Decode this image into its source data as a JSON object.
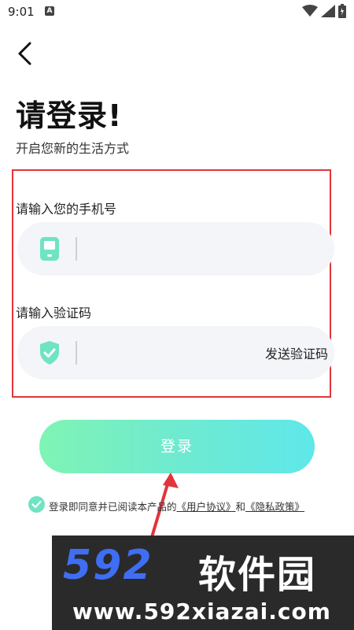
{
  "status_bar": {
    "time": "9:01",
    "notification_glyph": "A",
    "icons": [
      "wifi-icon",
      "signal-icon",
      "battery-icon"
    ]
  },
  "header": {
    "back_icon": "chevron-left-icon",
    "title": "请登录!",
    "subtitle": "开启您新的生活方式"
  },
  "form": {
    "phone_label": "请输入您的手机号",
    "phone_value": "",
    "phone_icon": "phone-icon",
    "code_label": "请输入验证码",
    "code_value": "",
    "code_icon": "shield-check-icon",
    "send_code_label": "发送验证码"
  },
  "login_button": {
    "label": "登录"
  },
  "agreement": {
    "checked": true,
    "prefix": "登录即同意并已阅读本产品的",
    "user_agreement": "《用户协议》",
    "conjunction": "和",
    "privacy_policy": "《隐私政策》"
  },
  "watermark": {
    "logo": "592",
    "brand": "软件园",
    "url": "www.592xiazai.com"
  },
  "colors": {
    "accent_green": "#7ff4b4",
    "accent_cyan": "#5fe7ea",
    "highlight_red": "#e0353b",
    "input_bg": "#f4f5f8"
  }
}
